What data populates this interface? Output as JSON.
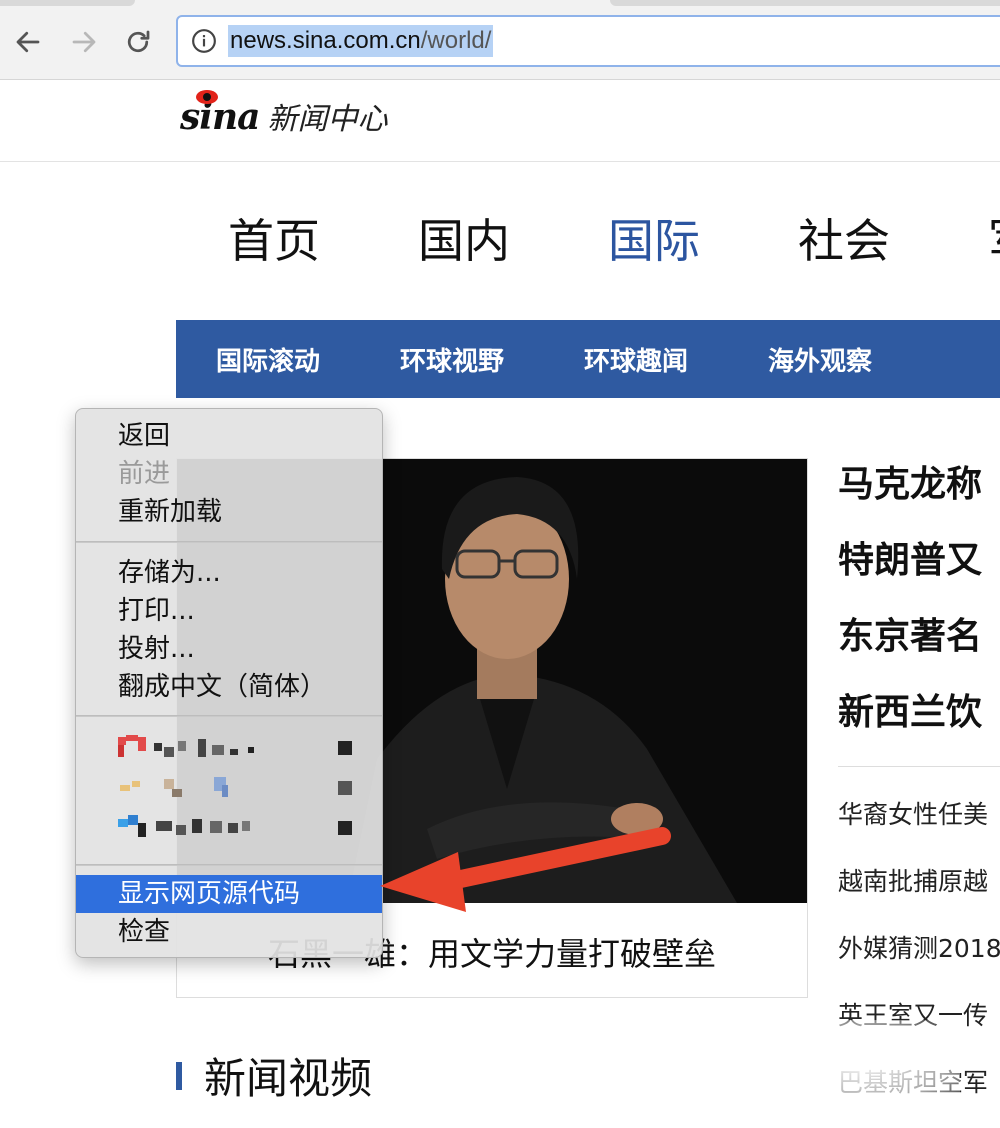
{
  "browser": {
    "url_host": "news.sina.com.cn",
    "url_path": "/world/",
    "icons": [
      "back-icon",
      "forward-icon",
      "reload-icon",
      "info-icon"
    ]
  },
  "site": {
    "logo_brand": "sina",
    "logo_text": "新闻中心"
  },
  "main_nav": [
    {
      "label": "首页",
      "active": false
    },
    {
      "label": "国内",
      "active": false
    },
    {
      "label": "国际",
      "active": true
    },
    {
      "label": "社会",
      "active": false
    }
  ],
  "sub_nav": [
    "国际滚动",
    "环球视野",
    "环球趣闻",
    "海外观察"
  ],
  "feature": {
    "caption": "石黑一雄：用文学力量打破壁垒"
  },
  "headlines": [
    "马克龙称",
    "特朗普又",
    "东京著名",
    "新西兰饮"
  ],
  "news_list": [
    "华裔女性任美",
    "越南批捕原越",
    "外媒猜测2018",
    "英王室又一传",
    "巴基斯坦空军"
  ],
  "video_section": {
    "title": "新闻视频"
  },
  "context_menu": {
    "groups": [
      [
        {
          "label": "返回",
          "disabled": false
        },
        {
          "label": "前进",
          "disabled": true
        },
        {
          "label": "重新加载",
          "disabled": false
        }
      ],
      [
        {
          "label": "存储为...",
          "disabled": false
        },
        {
          "label": "打印...",
          "disabled": false
        },
        {
          "label": "投射...",
          "disabled": false
        },
        {
          "label": "翻成中文（简体）",
          "disabled": false
        }
      ],
      [
        {
          "label": "显示网页源代码",
          "highlighted": true
        },
        {
          "label": "检查",
          "disabled": false
        }
      ]
    ]
  },
  "colors": {
    "accent_blue": "#2f5aa1",
    "highlight_blue": "#2f6fdd",
    "arrow_red": "#e8432b"
  }
}
